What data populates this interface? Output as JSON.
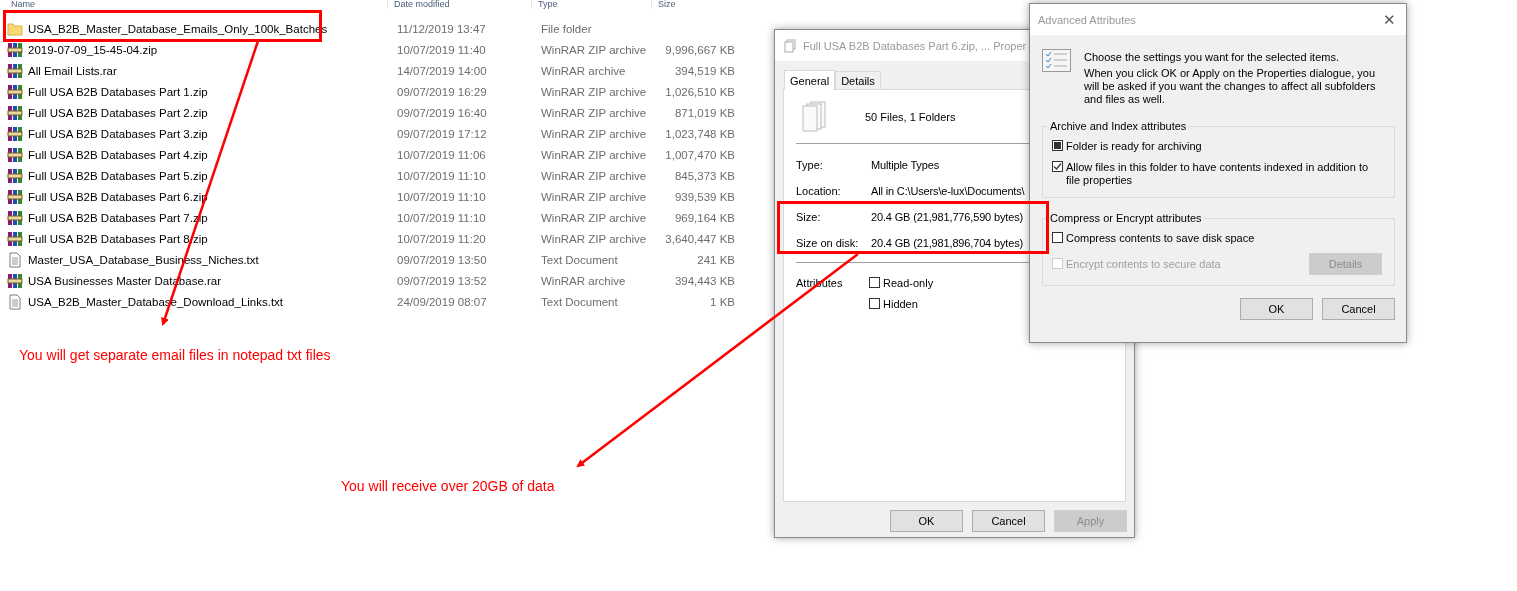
{
  "file_list": {
    "columns": [
      "Name",
      "Date modified",
      "Type",
      "Size"
    ],
    "rows": [
      {
        "kind": "folder",
        "name": "USA_B2B_Master_Database_Emails_Only_100k_Batches",
        "date": "11/12/2019 13:47",
        "type": "File folder",
        "size": ""
      },
      {
        "kind": "archive",
        "name": "2019-07-09_15-45-04.zip",
        "date": "10/07/2019 11:40",
        "type": "WinRAR ZIP archive",
        "size": "9,996,667 KB"
      },
      {
        "kind": "archive",
        "name": "All Email Lists.rar",
        "date": "14/07/2019 14:00",
        "type": "WinRAR archive",
        "size": "394,519 KB"
      },
      {
        "kind": "archive",
        "name": "Full USA B2B Databases Part 1.zip",
        "date": "09/07/2019 16:29",
        "type": "WinRAR ZIP archive",
        "size": "1,026,510 KB"
      },
      {
        "kind": "archive",
        "name": "Full USA B2B Databases Part 2.zip",
        "date": "09/07/2019 16:40",
        "type": "WinRAR ZIP archive",
        "size": "871,019 KB"
      },
      {
        "kind": "archive",
        "name": "Full USA B2B Databases Part 3.zip",
        "date": "09/07/2019 17:12",
        "type": "WinRAR ZIP archive",
        "size": "1,023,748 KB"
      },
      {
        "kind": "archive",
        "name": "Full USA B2B Databases Part 4.zip",
        "date": "10/07/2019 11:06",
        "type": "WinRAR ZIP archive",
        "size": "1,007,470 KB"
      },
      {
        "kind": "archive",
        "name": "Full USA B2B Databases Part 5.zip",
        "date": "10/07/2019 11:10",
        "type": "WinRAR ZIP archive",
        "size": "845,373 KB"
      },
      {
        "kind": "archive",
        "name": "Full USA B2B Databases Part 6.zip",
        "date": "10/07/2019 11:10",
        "type": "WinRAR ZIP archive",
        "size": "939,539 KB"
      },
      {
        "kind": "archive",
        "name": "Full USA B2B Databases Part 7.zip",
        "date": "10/07/2019 11:10",
        "type": "WinRAR ZIP archive",
        "size": "969,164 KB"
      },
      {
        "kind": "archive",
        "name": "Full USA B2B Databases Part 8.zip",
        "date": "10/07/2019 11:20",
        "type": "WinRAR ZIP archive",
        "size": "3,640,447 KB"
      },
      {
        "kind": "text",
        "name": "Master_USA_Database_Business_Niches.txt",
        "date": "09/07/2019 13:50",
        "type": "Text Document",
        "size": "241 KB"
      },
      {
        "kind": "archive",
        "name": "USA Businesses Master Database.rar",
        "date": "09/07/2019 13:52",
        "type": "WinRAR archive",
        "size": "394,443 KB"
      },
      {
        "kind": "text",
        "name": "USA_B2B_Master_Database_Download_Links.txt",
        "date": "24/09/2019 08:07",
        "type": "Text Document",
        "size": "1 KB"
      }
    ]
  },
  "properties_dialog": {
    "title": "Full USA B2B Databases Part 6.zip, ... Proper",
    "tabs": [
      {
        "label": "General",
        "selected": true
      },
      {
        "label": "Details",
        "selected": false
      }
    ],
    "summary": "50 Files, 1 Folders",
    "fields": [
      {
        "label": "Type:",
        "value": "Multiple Types"
      },
      {
        "label": "Location:",
        "value": "All in C:\\Users\\e-lux\\Documents\\"
      }
    ],
    "size_fields": [
      {
        "label": "Size:",
        "value": "20.4 GB (21,981,776,590 bytes)"
      },
      {
        "label": "Size on disk:",
        "value": "20.4 GB (21,981,896,704 bytes)"
      }
    ],
    "attributes_label": "Attributes",
    "attributes": [
      {
        "label": "Read-only",
        "checked": false
      },
      {
        "label": "Hidden",
        "checked": false
      }
    ],
    "buttons": [
      {
        "label": "OK",
        "disabled": false
      },
      {
        "label": "Cancel",
        "disabled": false
      },
      {
        "label": "Apply",
        "disabled": true
      }
    ]
  },
  "advanced_dialog": {
    "title": "Advanced Attributes",
    "close": "✕",
    "intro": "Choose the settings you want for the selected items.",
    "note": "When you click OK or Apply on the Properties dialogue, you will be asked if you want the changes to affect all subfolders and files as well.",
    "groups": [
      {
        "title": "Archive and Index attributes",
        "options": [
          {
            "label": "Folder is ready for archiving",
            "checked": true,
            "indeterminate": true,
            "disabled": false
          },
          {
            "label": "Allow files in this folder to have contents indexed in addition to file properties",
            "checked": true,
            "indeterminate": false,
            "disabled": false
          }
        ]
      },
      {
        "title": "Compress or Encrypt attributes",
        "options": [
          {
            "label": "Compress contents to save disk space",
            "checked": false,
            "indeterminate": false,
            "disabled": false
          },
          {
            "label": "Encrypt contents to secure data",
            "checked": false,
            "indeterminate": false,
            "disabled": true
          }
        ],
        "button": {
          "label": "Details",
          "disabled": true
        }
      }
    ],
    "buttons": [
      {
        "label": "OK",
        "disabled": false
      },
      {
        "label": "Cancel",
        "disabled": false
      }
    ]
  },
  "annotations": [
    {
      "text": "You will get separate email files in notepad txt files"
    },
    {
      "text": "You will receive over 20GB of data"
    }
  ]
}
